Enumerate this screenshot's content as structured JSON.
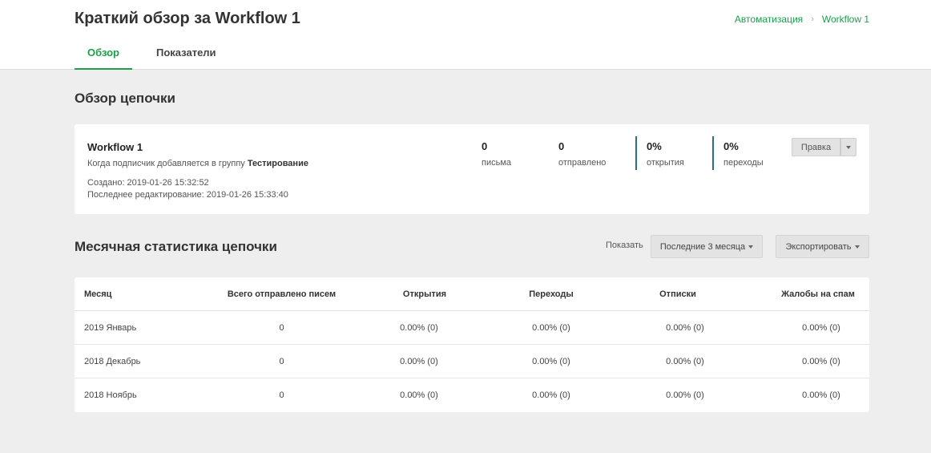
{
  "header": {
    "title": "Краткий обзор за Workflow 1",
    "breadcrumb": [
      "Автоматизация",
      "Workflow 1"
    ],
    "tabs": [
      {
        "label": "Обзор",
        "active": true
      },
      {
        "label": "Показатели",
        "active": false
      }
    ]
  },
  "overview": {
    "section_title": "Обзор цепочки",
    "workflow": {
      "name": "Workflow 1",
      "description_prefix": "Когда подписчик добавляется в группу",
      "description_group": "Тестирование",
      "created_label": "Создано:",
      "created_value": "2019-01-26 15:32:52",
      "edited_label": "Последнее редактирование:",
      "edited_value": "2019-01-26 15:33:40"
    },
    "stats": [
      {
        "value": "0",
        "label": "письма"
      },
      {
        "value": "0",
        "label": "отправлено"
      },
      {
        "value": "0%",
        "label": "открытия"
      },
      {
        "value": "0%",
        "label": "переходы"
      }
    ],
    "edit_button": "Правка",
    "accent_color": "#2a6f8a"
  },
  "monthly": {
    "section_title": "Месячная статистика цепочки",
    "show_label": "Показать",
    "period_dropdown": "Последние 3 месяца",
    "export_dropdown": "Экспортировать",
    "columns": [
      "Месяц",
      "Всего отправлено писем",
      "Открытия",
      "Переходы",
      "Отписки",
      "Жалобы на спам"
    ],
    "rows": [
      [
        "2019 Январь",
        "0",
        "0.00% (0)",
        "0.00% (0)",
        "0.00% (0)",
        "0.00% (0)"
      ],
      [
        "2018 Декабрь",
        "0",
        "0.00% (0)",
        "0.00% (0)",
        "0.00% (0)",
        "0.00% (0)"
      ],
      [
        "2018 Ноябрь",
        "0",
        "0.00% (0)",
        "0.00% (0)",
        "0.00% (0)",
        "0.00% (0)"
      ]
    ]
  },
  "colors": {
    "brand_green": "#1e9e4a",
    "background": "#eeeeee"
  }
}
